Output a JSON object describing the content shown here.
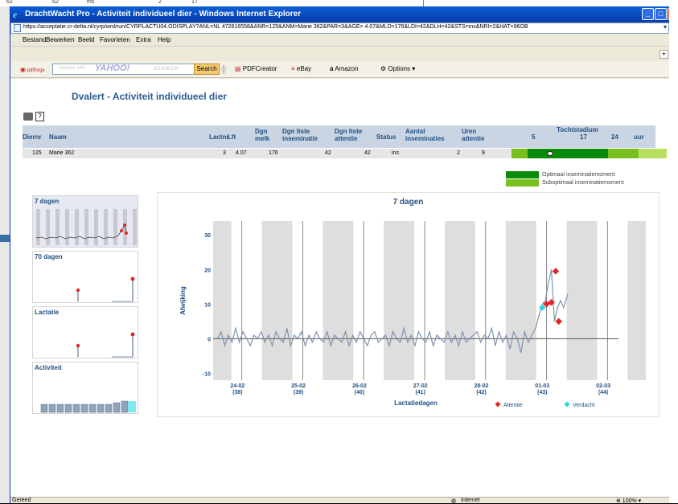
{
  "background": {
    "strip_values": [
      "62",
      "62",
      "ms",
      "2",
      "17"
    ]
  },
  "window": {
    "title": "DrachtWacht Pro - Activiteit individueel dier - Windows Internet Explorer",
    "controls": [
      "_",
      "□",
      "X"
    ]
  },
  "address": {
    "url": "https://acceptatie.cr-delta.nl/cyrp/wrd/run/CYRPLACTU04.ODISPLAY?ANL=NL 472616558&ANR=125&ANM=Marie 362&PAR=3&AGE= 4.07&MLD=176&LDI=42&DLH=42&STS=ins&NRI=2&HAT=96OB"
  },
  "menu": [
    "Bestand",
    "Bewerken",
    "Beeld",
    "Favorieten",
    "Extra",
    "Help"
  ],
  "toolbar": {
    "pdfforge": "pdfforge",
    "search_placeholder": "explore with",
    "yahoo": "YAHOO!",
    "search_text": "SEARCH",
    "search_button": "Search",
    "pdfcreator": "PDFCreator",
    "ebay": "eBay",
    "amazon": "Amazon",
    "options": "Options"
  },
  "page": {
    "title": "Dvalert - Activiteit individueel dier"
  },
  "table": {
    "headers": [
      "Diernr",
      "Naam",
      "Lactnr",
      "Lft",
      "Dgn melk",
      "Dgn ltste inseminatie",
      "Dgn ltste attentie",
      "Status",
      "Aantal inseminaties",
      "Uren attentie",
      "Tochtstadium"
    ],
    "stadium_ticks": [
      "5",
      "17",
      "24",
      "uur"
    ],
    "row": {
      "diernr": "125",
      "naam": "Marie 362",
      "lactnr": "3",
      "lft": "4.07",
      "dgn_melk": "176",
      "dgn_ins": "42",
      "dgn_att": "42",
      "status": "ins",
      "aantal_ins": "2",
      "uren_att": "9"
    }
  },
  "legend": {
    "optimal": "Optimaal inseminatiemoment",
    "suboptimal": "Suboptimaal inseminatiemoment",
    "optimal_color": "#0a8a0a",
    "suboptimal_color": "#78c020"
  },
  "thumbnails": [
    {
      "label": "7 dagen"
    },
    {
      "label": "70 dagen"
    },
    {
      "label": "Lactatie"
    },
    {
      "label": "Activiteit"
    }
  ],
  "chart_data": {
    "type": "line",
    "title": "7 dagen",
    "xlabel": "Lactatiedagen",
    "ylabel": "Afwijking",
    "ylim": [
      -12,
      34
    ],
    "yticks": [
      -10,
      0,
      10,
      20,
      30
    ],
    "xlim": [
      23.8,
      30.45
    ],
    "xticks": [
      {
        "x": 24.2,
        "date": "24-02",
        "day": "(38)"
      },
      {
        "x": 25.2,
        "date": "25-02",
        "day": "(39)"
      },
      {
        "x": 26.2,
        "date": "26-02",
        "day": "(40)"
      },
      {
        "x": 27.2,
        "date": "27-02",
        "day": "(41)"
      },
      {
        "x": 28.2,
        "date": "28-02",
        "day": "(42)"
      },
      {
        "x": 29.2,
        "date": "01-03",
        "day": "(43)"
      },
      {
        "x": 30.2,
        "date": "02-03",
        "day": "(44)"
      }
    ],
    "gray_bands": [
      [
        23.8,
        24.1
      ],
      [
        24.6,
        25.1
      ],
      [
        25.6,
        26.1
      ],
      [
        26.6,
        27.1
      ],
      [
        27.6,
        28.1
      ],
      [
        28.6,
        29.1
      ],
      [
        29.6,
        30.1
      ],
      [
        30.6,
        30.9
      ]
    ],
    "line_color": "#7d93ad",
    "series": [
      {
        "name": "",
        "x": [
          23.87,
          23.93,
          23.99,
          24.05,
          24.11,
          24.17,
          24.23,
          24.29,
          24.35,
          24.41,
          24.47,
          24.53,
          24.59,
          24.65,
          24.71,
          24.77,
          24.83,
          24.89,
          24.95,
          25.01,
          25.07,
          25.13,
          25.19,
          25.25,
          25.31,
          25.37,
          25.43,
          25.49,
          25.55,
          25.61,
          25.67,
          25.73,
          25.79,
          25.85,
          25.91,
          25.97,
          26.03,
          26.09,
          26.15,
          26.21,
          26.27,
          26.33,
          26.39,
          26.45,
          26.51,
          26.57,
          26.63,
          26.69,
          26.75,
          26.81,
          26.87,
          26.93,
          26.99,
          27.05,
          27.11,
          27.17,
          27.23,
          27.29,
          27.35,
          27.41,
          27.47,
          27.53,
          27.59,
          27.65,
          27.71,
          27.77,
          27.83,
          27.89,
          27.95,
          28.01,
          28.07,
          28.13,
          28.19,
          28.25,
          28.31,
          28.37,
          28.43,
          28.49,
          28.55,
          28.61,
          28.67,
          28.73,
          28.79,
          28.85,
          28.91,
          28.97,
          29.03,
          29.09,
          29.15,
          29.2,
          29.25,
          29.3,
          29.35,
          29.4,
          29.45,
          29.5,
          29.55,
          29.62
        ],
        "y": [
          0,
          2,
          -2,
          1,
          -1,
          3,
          -1,
          2,
          0,
          -2,
          1,
          0,
          2,
          -1,
          1,
          -2,
          2,
          0,
          -1,
          3,
          -2,
          1,
          0,
          2,
          -2,
          1,
          -1,
          2,
          0,
          -1,
          2,
          -2,
          1,
          0,
          -1,
          2,
          -2,
          1,
          -1,
          2,
          0,
          -2,
          1,
          2,
          -1,
          0,
          1,
          -2,
          2,
          0,
          -1,
          3,
          -1,
          1,
          -2,
          2,
          0,
          -1,
          2,
          -2,
          1,
          0,
          -1,
          2,
          -1,
          1,
          -2,
          2,
          -1,
          0,
          1,
          2,
          -1,
          1,
          0,
          3,
          -2,
          2,
          -1,
          1,
          -3,
          2,
          0,
          -4,
          2,
          -1,
          1,
          3,
          7,
          10,
          11,
          16,
          20,
          5,
          9,
          11,
          9,
          13
        ]
      }
    ],
    "markers": [
      {
        "name": "Attentie",
        "color": "#e02828",
        "points": [
          [
            29.27,
            10
          ],
          [
            29.35,
            10.5
          ],
          [
            29.42,
            19.5
          ],
          [
            29.47,
            5
          ]
        ]
      },
      {
        "name": "Verdacht",
        "color": "#30d8e0",
        "points": [
          [
            29.2,
            9
          ]
        ]
      }
    ]
  }
}
